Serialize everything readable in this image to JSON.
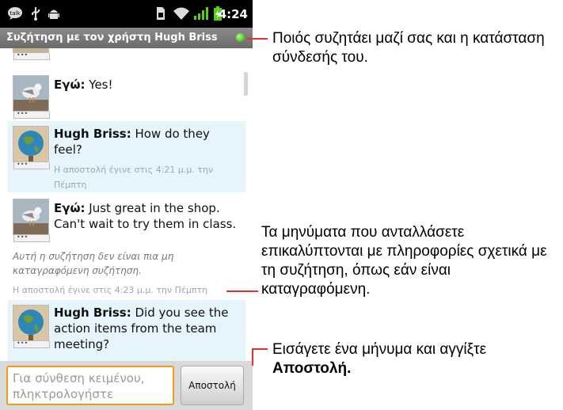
{
  "status_bar": {
    "time": "4:24",
    "icons": [
      "talk-icon",
      "usb-icon",
      "android-debug-icon",
      "sim-icon",
      "wifi-icon",
      "signal-icon",
      "battery-charging-icon"
    ]
  },
  "title_bar": {
    "title": "Συζήτηση με τον χρήστη Hugh Briss",
    "presence": "online",
    "presence_color": "#3ec61b"
  },
  "messages": [
    {
      "sender": "Εγώ:",
      "text": " Yes!"
    },
    {
      "sender": "Hugh Briss:",
      "text": " How do they feel?",
      "meta": "Η αποστολή έγινε στις 4:21 μ.μ. την Πέμπτη"
    },
    {
      "sender": "Εγώ:",
      "text": " Just great in the shop. Can't wait to try them in class."
    },
    {
      "sender": "Hugh Briss:",
      "text": " Did you see the action items from the team meeting?"
    }
  ],
  "notice": {
    "text": "Αυτή η συζήτηση δεν είναι πια μη καταγραφόμενη συζήτηση.",
    "meta": "Η αποστολή έγινε στις 4:23 μ.μ. την Πέμπτη"
  },
  "composer": {
    "placeholder": "Για σύνθεση κειμένου, πληκτρολογήστε",
    "send_label": "Αποστολή",
    "accent_color": "#ef9a1a"
  },
  "callouts": {
    "top": "Ποιός συζητάει μαζί σας και η κατάσταση σύνδεσής του.",
    "middle": "Τα μηνύματα που ανταλλάσετε επικαλύπτονται με πληροφορίες σχετικά με τη συζήτηση, όπως εάν είναι καταγραφόμενη.",
    "bottom_text": "Εισάγετε ένα μήνυμα και αγγίξτε",
    "bottom_bold": "Αποστολή.",
    "line_color": "#e03030"
  }
}
